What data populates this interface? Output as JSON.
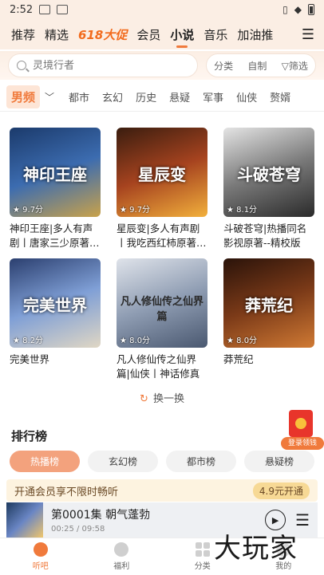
{
  "status_bar": {
    "time": "2:52",
    "battery_icon": "battery-icon",
    "wifi_icon": "wifi-icon",
    "vibrate_icon": "vibrate-icon"
  },
  "top_nav": {
    "tabs": [
      "推荐",
      "精选",
      "618大促",
      "会员",
      "小说",
      "音乐",
      "加油推"
    ],
    "active": "小说",
    "menu_icon": "menu-icon"
  },
  "search": {
    "placeholder": "灵境行者",
    "options": [
      "分类",
      "自制",
      "筛选"
    ]
  },
  "category_tabs": {
    "gender": "男频",
    "categories": [
      "都市",
      "玄幻",
      "历史",
      "悬疑",
      "军事",
      "仙侠",
      "赘婿"
    ]
  },
  "books": [
    {
      "cover_title": "神印王座",
      "rating": "9.7分",
      "name": "神印王座|多人有声剧丨唐家三少原著…",
      "colors": [
        "#1b3a6b",
        "#3c6cb0",
        "#c9a24a"
      ]
    },
    {
      "cover_title": "星辰变",
      "rating": "9.7分",
      "name": "星辰变|多人有声剧丨我吃西红柿原著…",
      "colors": [
        "#3a1d0f",
        "#a6431f",
        "#f2b03c"
      ]
    },
    {
      "cover_title": "斗破苍穹",
      "rating": "8.1分",
      "name": "斗破苍穹|热播同名影视原著--精校版",
      "colors": [
        "#e4e4e4",
        "#7a7a7a",
        "#2a2a2a"
      ]
    },
    {
      "cover_title": "完美世界",
      "rating": "8.2分",
      "name": "完美世界",
      "colors": [
        "#2b3f6f",
        "#7f9fd6",
        "#e0d7c4"
      ]
    },
    {
      "cover_title": "凡人修仙传之仙界篇",
      "rating": "8.0分",
      "name": "凡人修仙传之仙界篇|仙侠丨神话修真",
      "colors": [
        "#dfe3ea",
        "#8f9db3",
        "#4a5870"
      ]
    },
    {
      "cover_title": "莽荒纪",
      "rating": "8.0分",
      "name": "莽荒纪",
      "colors": [
        "#2a130a",
        "#7b3a18",
        "#d07a34"
      ]
    }
  ],
  "refresh_label": "换一换",
  "ranking": {
    "title": "排行榜",
    "tabs": [
      "热播榜",
      "玄幻榜",
      "都市榜",
      "悬疑榜"
    ],
    "active": "热播榜"
  },
  "gift": {
    "label": "登录领钱"
  },
  "vip_bar": {
    "text": "开通会员享不限时畅听",
    "button": "4.9元开通"
  },
  "player": {
    "title": "第0001集 朝气蓬勃",
    "time": "00:25 / 09:58"
  },
  "bottom_nav": {
    "items": [
      "听吧",
      "福利",
      "分类",
      "我的"
    ],
    "active": "听吧"
  },
  "watermark": "大玩家"
}
